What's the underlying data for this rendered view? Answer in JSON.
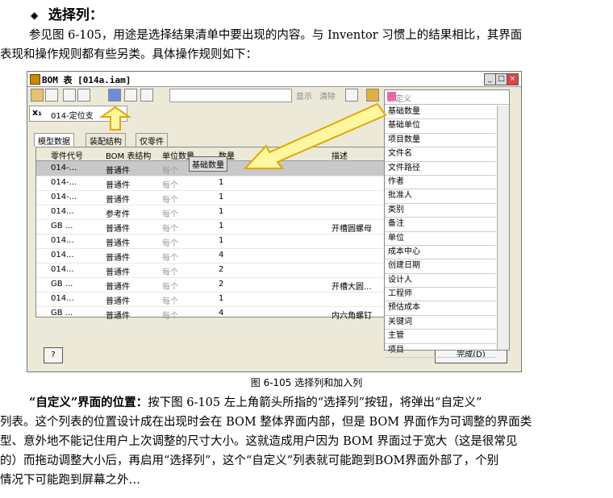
{
  "heading": {
    "bullet": "◆",
    "text": "选择列："
  },
  "para1": {
    "line1": "参见图 6-105，用途是选择结果清单中要出现的内容。与 Inventor 习惯上的结果相比，其界面",
    "line2": "表现和操作规则都有些另类。具体操作规则如下："
  },
  "window": {
    "title": "BOM 表 [014a.iam]",
    "toolbar_show": "显示",
    "toolbar_clear": "清除",
    "filter_value": "014-定位支",
    "tabs": [
      "模型数据",
      "装配结构",
      "仅零件"
    ],
    "columns": [
      "零件代号",
      "BOM 表结构",
      "单位数量",
      "数量",
      "描述"
    ],
    "drag_label": "基础数量",
    "rows": [
      {
        "code": "014-...",
        "struct": "普通件",
        "unit": "每个",
        "qty": "",
        "desc": ""
      },
      {
        "code": "014-...",
        "struct": "普通件",
        "unit": "每个",
        "qty": "1",
        "desc": ""
      },
      {
        "code": "014-...",
        "struct": "普通件",
        "unit": "每个",
        "qty": "1",
        "desc": ""
      },
      {
        "code": "014...",
        "struct": "参考件",
        "unit": "每个",
        "qty": "1",
        "desc": ""
      },
      {
        "code": "GB ...",
        "struct": "普通件",
        "unit": "每个",
        "qty": "1",
        "desc": "开槽圆螺母"
      },
      {
        "code": "014...",
        "struct": "普通件",
        "unit": "每个",
        "qty": "1",
        "desc": ""
      },
      {
        "code": "014...",
        "struct": "普通件",
        "unit": "每个",
        "qty": "4",
        "desc": ""
      },
      {
        "code": "014...",
        "struct": "普通件",
        "unit": "每个",
        "qty": "2",
        "desc": ""
      },
      {
        "code": "GB ...",
        "struct": "普通件",
        "unit": "每个",
        "qty": "2",
        "desc": "开槽大圆..."
      },
      {
        "code": "014...",
        "struct": "普通件",
        "unit": "每个",
        "qty": "1",
        "desc": ""
      },
      {
        "code": "GB ...",
        "struct": "普通件",
        "unit": "每个",
        "qty": "4",
        "desc": "内六角螺钉"
      }
    ],
    "help_label": "?",
    "done_label": "完成(D)",
    "custom": {
      "title": "自定义",
      "items": [
        "基础数量",
        "基础单位",
        "项目数量",
        "文件名",
        "文件路径",
        "作者",
        "批准人",
        "类别",
        "备注",
        "单位",
        "成本中心",
        "创建日期",
        "设计人",
        "工程师",
        "预估成本",
        "关键词",
        "主管",
        "项目"
      ]
    }
  },
  "caption": "图 6-105 选择列和加入列",
  "para2": {
    "lead": "“自定义”界面的位置：",
    "line1": "按下图 6-105 左上角箭头所指的“选择列”按钮，将弹出“自定义”",
    "line2": "列表。这个列表的位置设计成在出现时会在 BOM 整体界面内部，但是 BOM 界面作为可调整的界面类",
    "line3": "型、意外地不能记住用户上次调整的尺寸大小。这就造成用户因为 BOM 界面过于宽大（这是很常见",
    "line4": "的）而拖动调整大小后，再启用“选择列”，这个“自定义”列表就可能跑到BOM界面外部了，个别",
    "line5": "情况下可能跑到屏幕之外…"
  },
  "colors": {
    "arrow_fill": "#fff7a0",
    "arrow_stroke": "#e0a800"
  }
}
